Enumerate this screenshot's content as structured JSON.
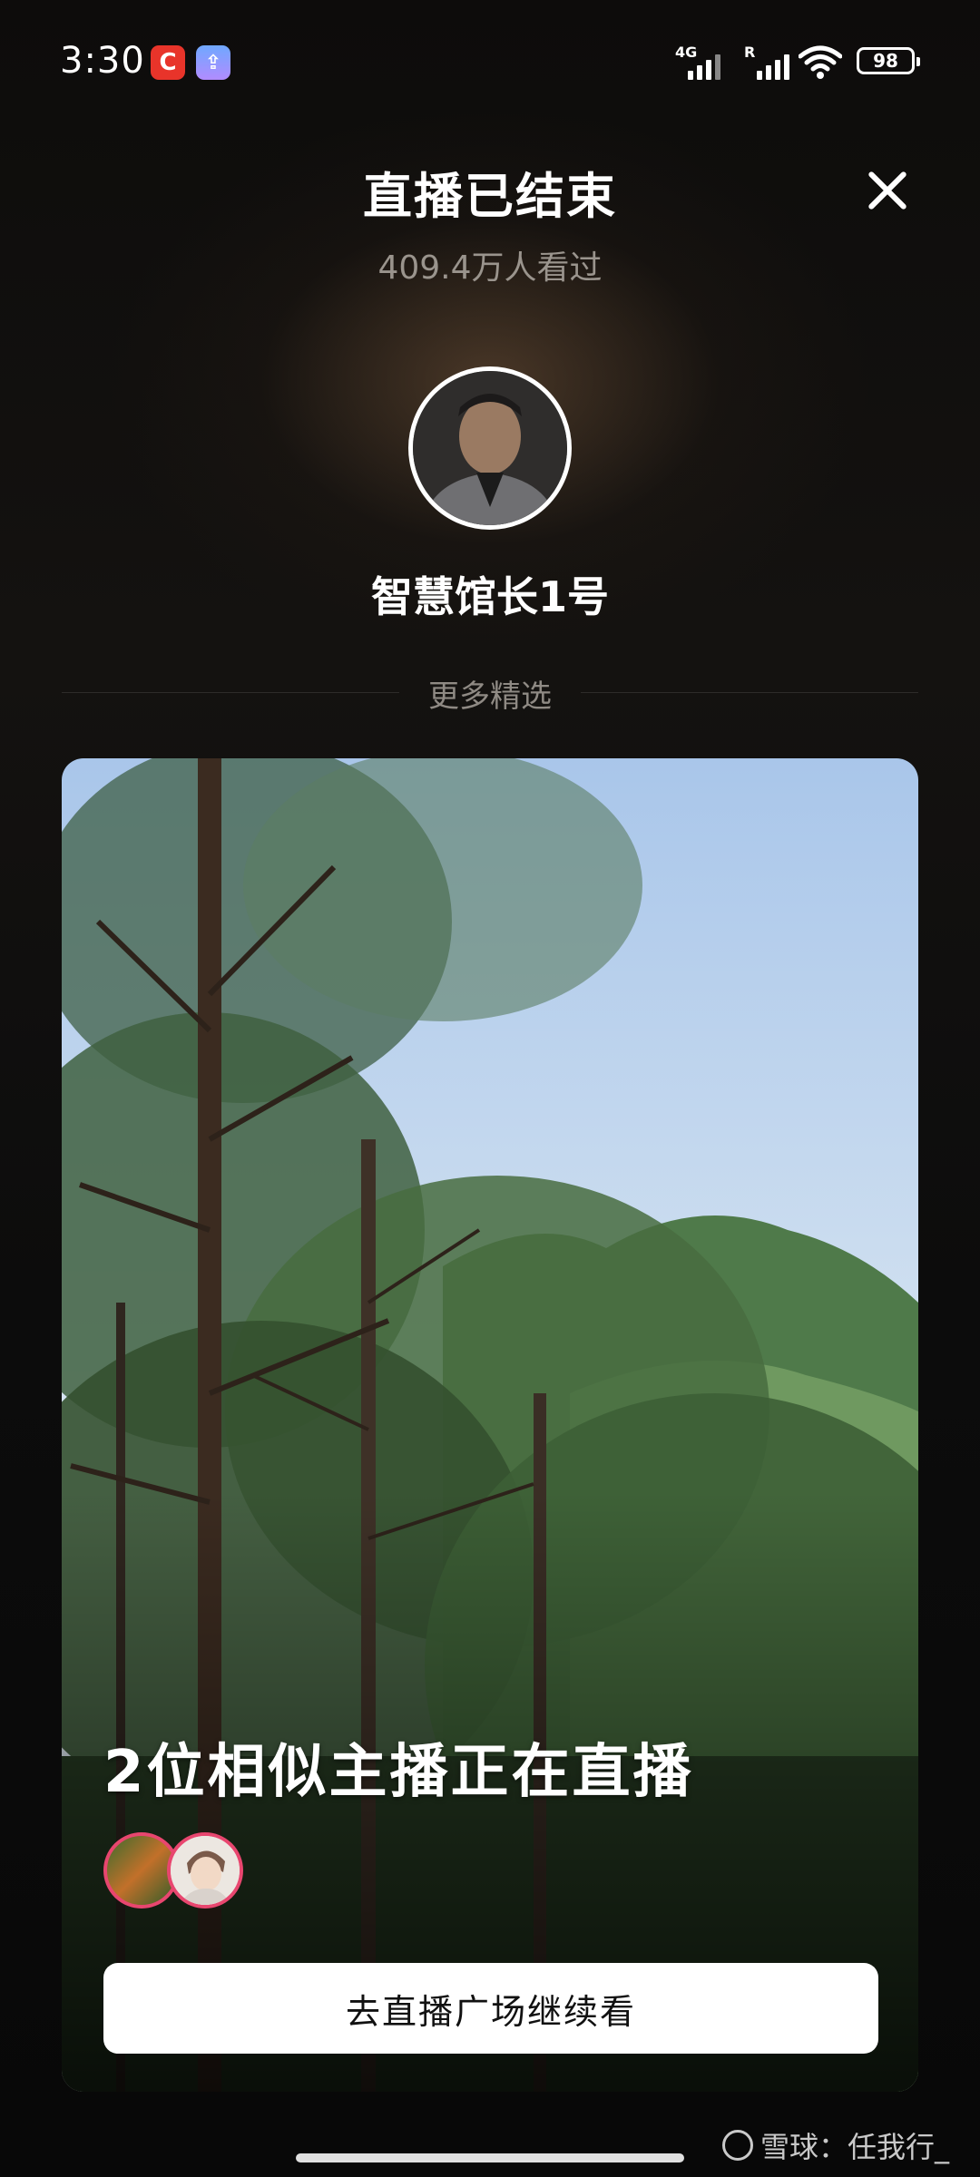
{
  "status_bar": {
    "time": "3:30",
    "network1": "4G",
    "network2": "R",
    "battery": "98",
    "app_icon_1": "C",
    "app_icon_2": "⇪"
  },
  "header": {
    "title": "直播已结束",
    "viewers": "409.4万人看过"
  },
  "host": {
    "name": "智慧馆长1号"
  },
  "section": {
    "label": "更多精选"
  },
  "card": {
    "headline": "2位相似主播正在直播",
    "cta_label": "去直播广场继续看"
  },
  "watermark": {
    "text": "雪球：任我行_"
  },
  "icons": [
    "close-icon",
    "wifi-icon",
    "battery-icon",
    "signal-icon"
  ],
  "colors": {
    "accent_ring": "#e8466f",
    "background": "#0b0b0b",
    "muted_text": "#9a948d"
  }
}
